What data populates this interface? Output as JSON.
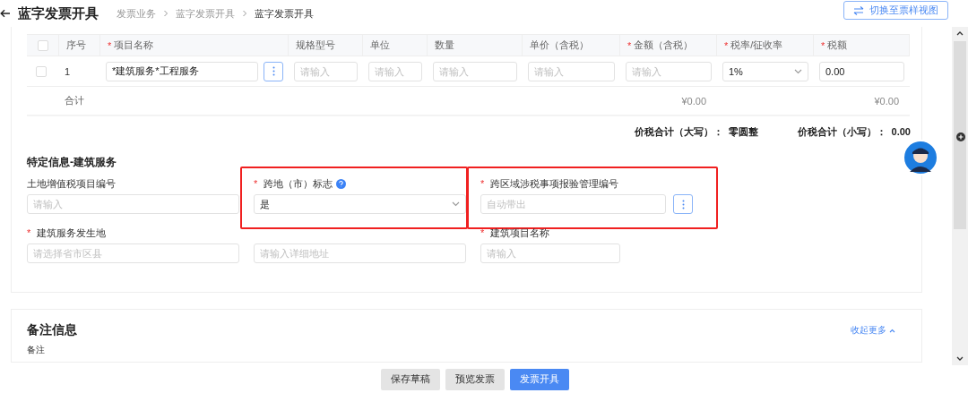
{
  "header": {
    "title": "蓝字发票开具",
    "breadcrumb": [
      {
        "label": "发票业务",
        "selected": false
      },
      {
        "label": "蓝字发票开具",
        "selected": false
      },
      {
        "label": "蓝字发票开具",
        "selected": true
      }
    ],
    "switch_button": "切换至票样视图"
  },
  "table": {
    "header_checked": false,
    "columns": [
      {
        "label": "序号"
      },
      {
        "label": "项目名称",
        "required_mark": "*"
      },
      {
        "label": "规格型号"
      },
      {
        "label": "单位"
      },
      {
        "label": "数量"
      },
      {
        "label": "单价（含税）"
      },
      {
        "label": "金额（含税）",
        "required_mark": "*"
      },
      {
        "label": "税率/征收率",
        "required_mark": "*"
      },
      {
        "label": "税额",
        "required_mark": "*"
      }
    ],
    "rows": [
      {
        "checked": false,
        "cells": [
          {
            "kind": "text",
            "value": "1"
          },
          {
            "kind": "input",
            "value": "*建筑服务*工程服务",
            "more_button": true
          },
          {
            "kind": "input",
            "placeholder": "请输入",
            "more_button": false
          },
          {
            "kind": "input",
            "placeholder": "请输入",
            "more_button": false
          },
          {
            "kind": "input",
            "placeholder": "请输入",
            "more_button": false
          },
          {
            "kind": "input",
            "placeholder": "请输入",
            "more_button": false
          },
          {
            "kind": "input",
            "placeholder": "请输入",
            "more_button": false
          },
          {
            "kind": "select",
            "value": "1%"
          },
          {
            "kind": "input",
            "value": "0.00",
            "more_button": false
          }
        ]
      }
    ],
    "total": {
      "label": "合计",
      "amount": "¥0.00",
      "tax": "¥0.00"
    },
    "summary": [
      {
        "label": "价税合计（大写）：",
        "value": "零圆整"
      },
      {
        "label": "价税合计（小写）：",
        "value": "0.00"
      }
    ]
  },
  "special_section": {
    "title": "特定信息-建筑服务",
    "fields": [
      {
        "kind": "input",
        "label": "土地增值税项目编号",
        "help": false,
        "highlighted": false,
        "placeholder": "请输入"
      },
      {
        "kind": "select",
        "label": "跨地（市）标志",
        "required_mark": "*",
        "help": true,
        "highlighted": true,
        "value": "是"
      },
      {
        "kind": "input_more",
        "label": "跨区域涉税事项报验管理编号",
        "required_mark": "*",
        "help": false,
        "highlighted": true,
        "placeholder": "自动带出"
      },
      {
        "kind": "address",
        "label": "建筑服务发生地",
        "required_mark": "*",
        "help": false,
        "highlighted": false,
        "placeholders": [
          "请选择省市区县",
          "请输入详细地址"
        ]
      },
      {
        "kind": "input",
        "label": "建筑项目名称",
        "required_mark": "*",
        "help": false,
        "highlighted": false,
        "placeholder": "请输入"
      }
    ]
  },
  "remarks": {
    "title": "备注信息",
    "collapse_link": "收起更多",
    "label": "备注"
  },
  "footer_buttons": [
    {
      "label": "保存草稿",
      "primary": false
    },
    {
      "label": "预览发票",
      "primary": false
    },
    {
      "label": "发票开具",
      "primary": true
    }
  ]
}
